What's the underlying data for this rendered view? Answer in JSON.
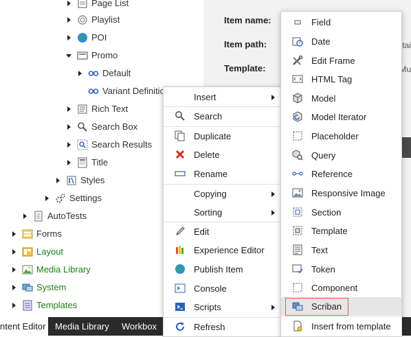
{
  "tree": {
    "items": [
      {
        "label": "Page List",
        "icon": "page-list-icon"
      },
      {
        "label": "Playlist",
        "icon": "playlist-icon"
      },
      {
        "label": "POI",
        "icon": "globe-icon"
      },
      {
        "label": "Promo",
        "icon": "promo-icon"
      },
      {
        "label": "Default",
        "icon": "variant-icon"
      },
      {
        "label": "Variant Definition",
        "icon": "variant-icon"
      },
      {
        "label": "Rich Text",
        "icon": "rich-text-icon"
      },
      {
        "label": "Search Box",
        "icon": "search-box-icon"
      },
      {
        "label": "Search Results",
        "icon": "search-results-icon"
      },
      {
        "label": "Title",
        "icon": "title-icon"
      },
      {
        "label": "Styles",
        "icon": "styles-icon"
      },
      {
        "label": "Settings",
        "icon": "settings-icon"
      },
      {
        "label": "AutoTests",
        "icon": "autotests-icon"
      },
      {
        "label": "Forms",
        "icon": "forms-icon"
      },
      {
        "label": "Layout",
        "icon": "layout-icon"
      },
      {
        "label": "Media Library",
        "icon": "media-library-icon"
      },
      {
        "label": "System",
        "icon": "system-icon"
      },
      {
        "label": "Templates",
        "icon": "templates-icon"
      }
    ]
  },
  "details": {
    "item_name_label": "Item name:",
    "item_path_label": "Item path:",
    "template_label": "Template:",
    "path_edge_text": "ntai",
    "template_edge_text": "t/Mu"
  },
  "taskbar": {
    "tabs": [
      "ntent Editor",
      "Media Library",
      "Workbox"
    ]
  },
  "context_menu": {
    "items": [
      {
        "label": "Insert",
        "submenu": true,
        "icon": ""
      },
      {
        "label": "Search",
        "icon": "search-icon"
      },
      {
        "label": "Duplicate",
        "icon": "duplicate-icon"
      },
      {
        "label": "Delete",
        "icon": "delete-icon"
      },
      {
        "label": "Rename",
        "icon": "rename-icon"
      },
      {
        "label": "Copying",
        "submenu": true,
        "icon": ""
      },
      {
        "label": "Sorting",
        "submenu": true,
        "icon": ""
      },
      {
        "label": "Edit",
        "icon": "edit-icon"
      },
      {
        "label": "Experience Editor",
        "icon": "experience-editor-icon"
      },
      {
        "label": "Publish Item",
        "icon": "publish-icon"
      },
      {
        "label": "Console",
        "icon": "console-icon"
      },
      {
        "label": "Scripts",
        "submenu": true,
        "icon": "scripts-icon"
      },
      {
        "label": "Refresh",
        "icon": "refresh-icon"
      }
    ]
  },
  "insert_submenu": {
    "items": [
      {
        "label": "Field",
        "icon": "field-icon"
      },
      {
        "label": "Date",
        "icon": "date-icon"
      },
      {
        "label": "Edit Frame",
        "icon": "edit-frame-icon"
      },
      {
        "label": "HTML Tag",
        "icon": "html-tag-icon"
      },
      {
        "label": "Model",
        "icon": "model-icon"
      },
      {
        "label": "Model Iterator",
        "icon": "model-iterator-icon"
      },
      {
        "label": "Placeholder",
        "icon": "placeholder-icon"
      },
      {
        "label": "Query",
        "icon": "query-icon"
      },
      {
        "label": "Reference",
        "icon": "reference-icon"
      },
      {
        "label": "Responsive Image",
        "icon": "responsive-image-icon"
      },
      {
        "label": "Section",
        "icon": "section-icon"
      },
      {
        "label": "Template",
        "icon": "template-icon"
      },
      {
        "label": "Text",
        "icon": "text-icon"
      },
      {
        "label": "Token",
        "icon": "token-icon"
      },
      {
        "label": "Component",
        "icon": "component-icon"
      },
      {
        "label": "Scriban",
        "icon": "scriban-icon",
        "highlighted": true
      },
      {
        "label": "Insert from template",
        "icon": "insert-from-template-icon"
      }
    ]
  },
  "colors": {
    "tree_green": "#1e7d14",
    "taskbar_bg": "#2b2b2b",
    "highlight_border": "#e05a4d"
  }
}
